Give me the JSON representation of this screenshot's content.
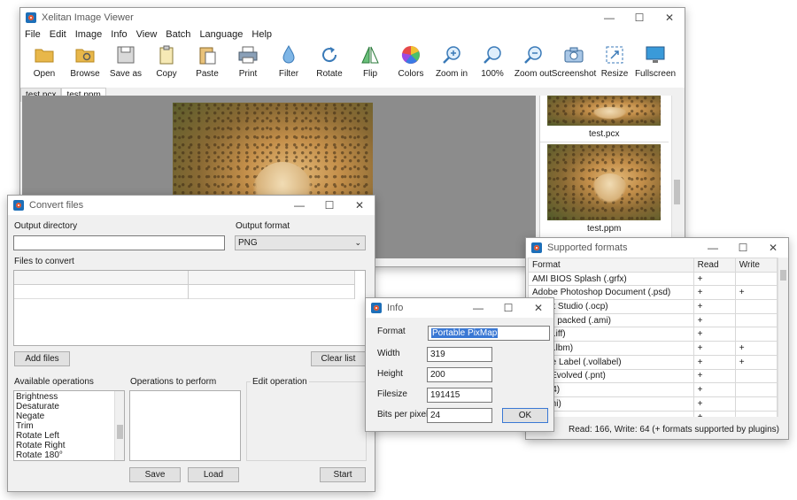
{
  "main_window": {
    "title": "Xelitan Image Viewer",
    "menu": [
      "File",
      "Edit",
      "Image",
      "Info",
      "View",
      "Batch",
      "Language",
      "Help"
    ],
    "toolbar": [
      {
        "label": "Open",
        "icon": "folder-open-icon"
      },
      {
        "label": "Browse",
        "icon": "folder-search-icon"
      },
      {
        "label": "Save as",
        "icon": "save-icon"
      },
      {
        "label": "Copy",
        "icon": "copy-icon"
      },
      {
        "label": "Paste",
        "icon": "paste-icon"
      },
      {
        "label": "Print",
        "icon": "printer-icon"
      },
      {
        "label": "Filter",
        "icon": "drop-icon"
      },
      {
        "label": "Rotate",
        "icon": "rotate-icon"
      },
      {
        "label": "Flip",
        "icon": "flip-icon"
      },
      {
        "label": "Colors",
        "icon": "color-wheel-icon"
      },
      {
        "label": "Zoom in",
        "icon": "zoom-in-icon"
      },
      {
        "label": "100%",
        "icon": "zoom-100-icon"
      },
      {
        "label": "Zoom out",
        "icon": "zoom-out-icon"
      },
      {
        "label": "Screenshot",
        "icon": "camera-icon"
      },
      {
        "label": "Resize",
        "icon": "resize-icon"
      },
      {
        "label": "Fullscreen",
        "icon": "monitor-icon"
      }
    ],
    "tabs": [
      "test.pcx",
      "test.ppm"
    ],
    "thumbnails": [
      "test.pcx",
      "test.ppm"
    ]
  },
  "convert": {
    "title": "Convert files",
    "output_directory_label": "Output directory",
    "output_directory_value": "",
    "output_format_label": "Output format",
    "output_format_value": "PNG",
    "files_label": "Files to convert",
    "add_files": "Add files",
    "clear_list": "Clear list",
    "available_label": "Available operations",
    "available_ops": [
      "Brightness",
      "Desaturate",
      "Negate",
      "Trim",
      "Rotate Left",
      "Rotate Right",
      "Rotate 180°"
    ],
    "perform_label": "Operations to perform",
    "edit_label": "Edit operation",
    "save": "Save",
    "load": "Load",
    "start": "Start"
  },
  "info": {
    "title": "Info",
    "format_label": "Format",
    "format_value": "Portable PixMap",
    "width_label": "Width",
    "width_value": "319",
    "height_label": "Height",
    "height_value": "200",
    "filesize_label": "Filesize",
    "filesize_value": "191415",
    "bpp_label": "Bits per pixel",
    "bpp_value": "24",
    "ok": "OK"
  },
  "formats": {
    "title": "Supported formats",
    "headers": [
      "Format",
      "Read",
      "Write"
    ],
    "rows": [
      [
        "AMI BIOS Splash (.grfx)",
        "+",
        ""
      ],
      [
        "Adobe Photoshop Document (.psd)",
        "+",
        "+"
      ],
      [
        "ed Art Studio (.ocp)",
        "+",
        ""
      ],
      [
        "Paint, packed (.ami)",
        "+",
        ""
      ],
      [
        ".BM (.iff)",
        "+",
        ""
      ],
      [
        ".BM (.lbm)",
        "+",
        "+"
      ],
      [
        "olume Label (.vollabel)",
        "+",
        "+"
      ],
      [
        "rival Evolved (.pnt)",
        "+",
        ""
      ],
      [
        "l (.a64)",
        "+",
        ""
      ],
      [
        "ll (.4mi)",
        "+",
        ""
      ],
      [
        "",
        "+",
        ""
      ]
    ],
    "status": "Read: 166, Write: 64 (+ formats supported by plugins)"
  }
}
